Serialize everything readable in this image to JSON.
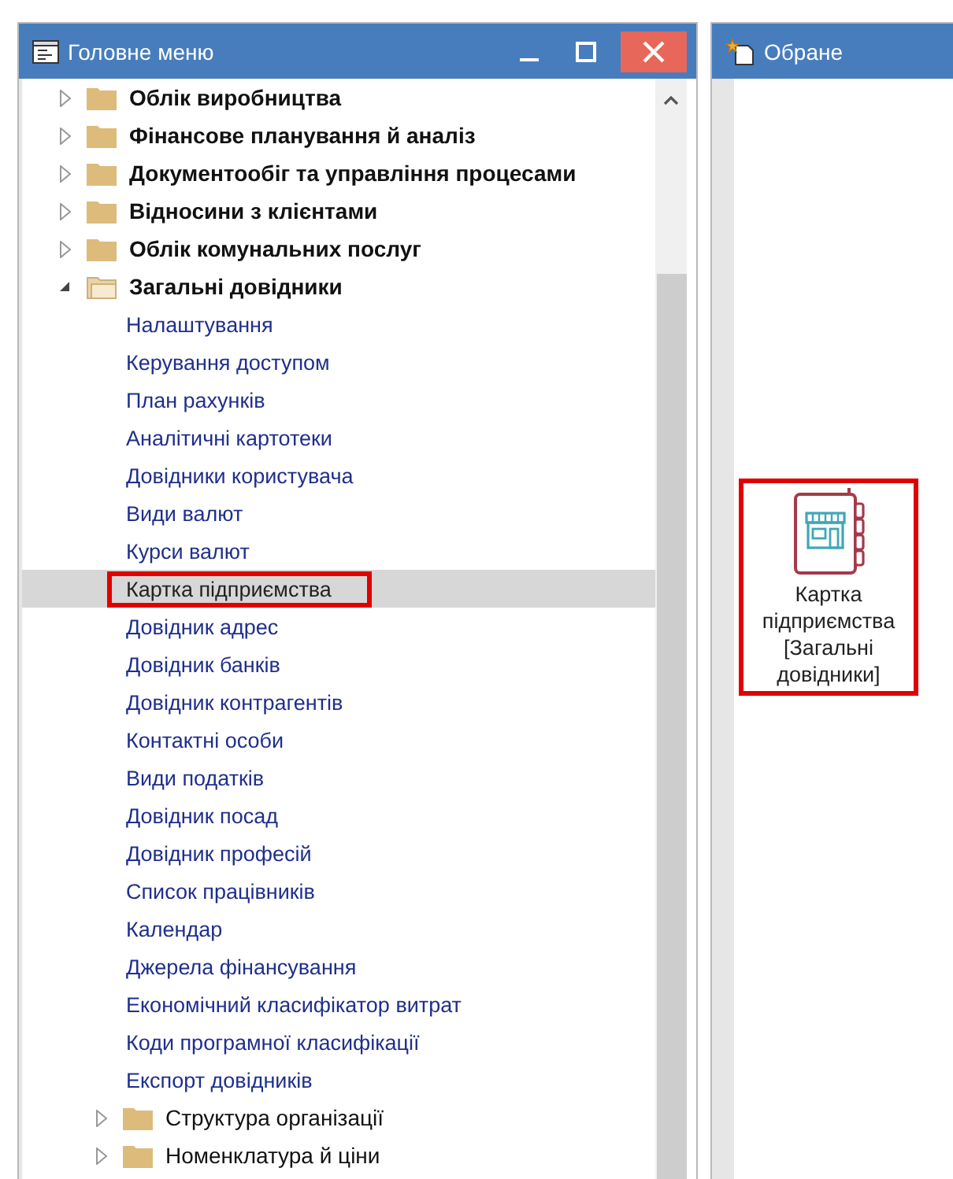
{
  "main_menu": {
    "title": "Головне меню",
    "tree": [
      {
        "label": "Облік виробництва",
        "expanded": false
      },
      {
        "label": "Фінансове планування й аналіз",
        "expanded": false
      },
      {
        "label": "Документообіг та управління процесами",
        "expanded": false
      },
      {
        "label": "Відносини з клієнтами",
        "expanded": false
      },
      {
        "label": "Облік комунальних послуг",
        "expanded": false
      },
      {
        "label": "Загальні довідники",
        "expanded": true,
        "children": [
          {
            "kind": "leaf",
            "label": "Налаштування",
            "selected": false
          },
          {
            "kind": "leaf",
            "label": "Керування доступом",
            "selected": false
          },
          {
            "kind": "leaf",
            "label": "План рахунків",
            "selected": false
          },
          {
            "kind": "leaf",
            "label": "Аналітичні картотеки",
            "selected": false
          },
          {
            "kind": "leaf",
            "label": "Довідники користувача",
            "selected": false
          },
          {
            "kind": "leaf",
            "label": "Види валют",
            "selected": false
          },
          {
            "kind": "leaf",
            "label": "Курси валют",
            "selected": false
          },
          {
            "kind": "leaf",
            "label": "Картка підприємства",
            "selected": true
          },
          {
            "kind": "leaf",
            "label": "Довідник адрес",
            "selected": false
          },
          {
            "kind": "leaf",
            "label": "Довідник банків",
            "selected": false
          },
          {
            "kind": "leaf",
            "label": "Довідник контрагентів",
            "selected": false
          },
          {
            "kind": "leaf",
            "label": "Контактні особи",
            "selected": false
          },
          {
            "kind": "leaf",
            "label": "Види податків",
            "selected": false
          },
          {
            "kind": "leaf",
            "label": "Довідник посад",
            "selected": false
          },
          {
            "kind": "leaf",
            "label": "Довідник професій",
            "selected": false
          },
          {
            "kind": "leaf",
            "label": "Список працівників",
            "selected": false
          },
          {
            "kind": "leaf",
            "label": "Календар",
            "selected": false
          },
          {
            "kind": "leaf",
            "label": "Джерела фінансування",
            "selected": false
          },
          {
            "kind": "leaf",
            "label": "Економічний класифікатор витрат",
            "selected": false
          },
          {
            "kind": "leaf",
            "label": "Коди програмної класифікації",
            "selected": false
          },
          {
            "kind": "leaf",
            "label": "Експорт довідників",
            "selected": false
          },
          {
            "kind": "folder",
            "label": "Структура організації",
            "selected": false
          },
          {
            "kind": "folder",
            "label": "Номенклатура й ціни",
            "selected": false
          }
        ]
      }
    ]
  },
  "favorites": {
    "title": "Обране",
    "tiles": [
      {
        "label": "Картка підприємства [Загальні довідники]",
        "selected": true
      }
    ]
  }
}
